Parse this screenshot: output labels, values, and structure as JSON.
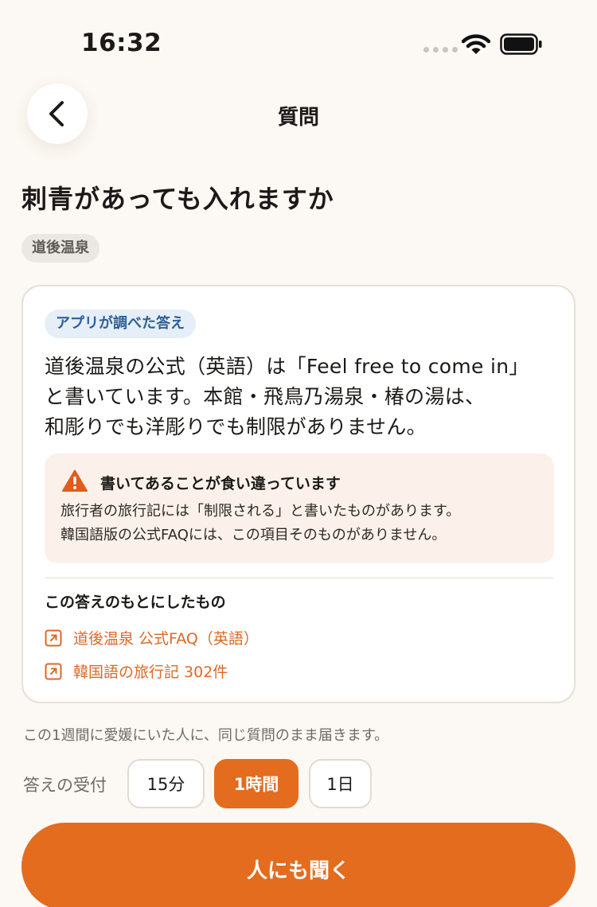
{
  "status_bar": {
    "time": "16:32"
  },
  "header": {
    "title": "質問",
    "back_icon": "chevron-left-icon"
  },
  "question": {
    "title": "刺青があっても入れますか",
    "tag": "道後温泉"
  },
  "answer_card": {
    "badge": "アプリが調べた答え",
    "lines": [
      "道後温泉の公式（英語）は「Feel free to come in」",
      "と書いています。本館・飛鳥乃湯泉・椿の湯は、",
      "和彫りでも洋彫りでも制限がありません。"
    ],
    "warning": {
      "icon": "warning-triangle-icon",
      "title": "書いてあることが食い違っています",
      "lines": [
        "旅行者の旅行記には「制限される」と書いたものがあります。",
        "韓国語版の公式FAQには、この項目そのものがありません。"
      ]
    },
    "sources_title": "この答えのもとにしたもの",
    "sources": [
      {
        "label": "道後温泉 公式FAQ（英語）",
        "icon": "external-link-icon"
      },
      {
        "label": "韓国語の旅行記 302件",
        "icon": "external-link-icon"
      }
    ]
  },
  "audience_note": "この1週間に愛媛にいた人に、同じ質問のまま届きます。",
  "deadline": {
    "label": "答えの受付",
    "options": [
      "15分",
      "1時間",
      "1日"
    ],
    "selected": "1時間"
  },
  "ask_button": "人にも聞く",
  "colors": {
    "accent": "#e46c1f",
    "link": "#d8692a",
    "background": "#fcf8f3",
    "warning_bg": "#fbf1ea",
    "badge_bg": "#e6eef7",
    "badge_text": "#2e5f95"
  }
}
